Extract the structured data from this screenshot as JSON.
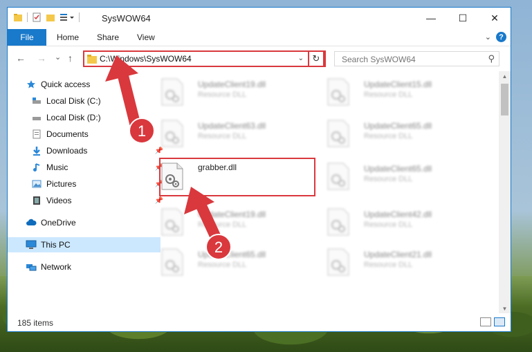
{
  "window": {
    "title": "SysWOW64",
    "controls": {
      "minimize": "—",
      "maximize": "☐",
      "close": "✕"
    }
  },
  "ribbon": {
    "file_tab": "File",
    "tabs": [
      "Home",
      "Share",
      "View"
    ],
    "help": "?"
  },
  "navigation": {
    "back": "←",
    "forward": "→",
    "recent": "⌄",
    "up": "↑",
    "address_path": "C:\\Windows\\SysWOW64",
    "refresh": "↻"
  },
  "search": {
    "placeholder": "Search SysWOW64"
  },
  "sidebar": {
    "items": [
      {
        "label": "Quick access",
        "icon": "star-icon",
        "pinned": false
      },
      {
        "label": "Local Disk (C:)",
        "icon": "drive-icon",
        "pinned": false
      },
      {
        "label": "Local Disk (D:)",
        "icon": "drive-icon",
        "pinned": false
      },
      {
        "label": "Documents",
        "icon": "documents-icon",
        "pinned": false
      },
      {
        "label": "Downloads",
        "icon": "download-icon",
        "pinned": true
      },
      {
        "label": "Music",
        "icon": "music-icon",
        "pinned": true
      },
      {
        "label": "Pictures",
        "icon": "pictures-icon",
        "pinned": true
      },
      {
        "label": "Videos",
        "icon": "videos-icon",
        "pinned": true
      },
      {
        "label": "OneDrive",
        "icon": "cloud-icon",
        "pinned": false
      },
      {
        "label": "This PC",
        "icon": "computer-icon",
        "pinned": false,
        "selected": true
      },
      {
        "label": "Network",
        "icon": "network-icon",
        "pinned": false
      }
    ]
  },
  "files": {
    "left": [
      {
        "name": "UpdateClient19.dll",
        "type": "Resource DLL"
      },
      {
        "name": "UpdateClient63.dll",
        "type": "Resource DLL"
      },
      {
        "name": "grabber.dll",
        "type": ""
      },
      {
        "name": "UpdateClient19.dll",
        "type": "Resource DLL"
      },
      {
        "name": "UpdateClient65.dll",
        "type": "Resource DLL"
      }
    ],
    "right": [
      {
        "name": "UpdateClient15.dll",
        "type": "Resource DLL"
      },
      {
        "name": "UpdateClient65.dll",
        "type": "Resource DLL"
      },
      {
        "name": "UpdateClient65.dll",
        "type": "Resource DLL"
      },
      {
        "name": "UpdateClient42.dll",
        "type": "Resource DLL"
      },
      {
        "name": "UpdateClient21.dll",
        "type": "Resource DLL"
      }
    ]
  },
  "annotations": {
    "step1": "1",
    "step2": "2"
  },
  "status": {
    "item_count": "185 items"
  },
  "colors": {
    "accent": "#1979ca",
    "highlight": "#d9383d",
    "selected": "#cce8ff"
  }
}
